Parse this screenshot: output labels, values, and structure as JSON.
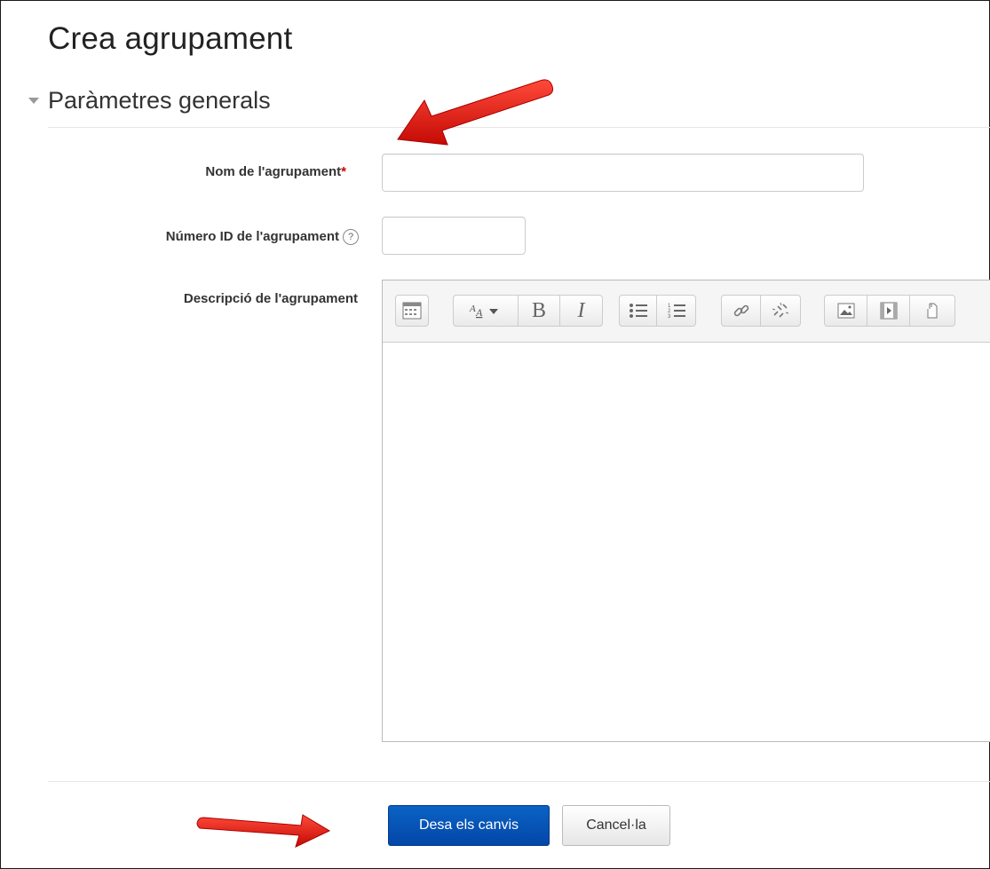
{
  "page": {
    "title": "Crea agrupament"
  },
  "section": {
    "title": "Paràmetres generals"
  },
  "form": {
    "name_label": "Nom de l'agrupament",
    "name_required": "*",
    "name_value": "",
    "idnumber_label": "Número ID de l'agrupament",
    "idnumber_help": "?",
    "idnumber_value": "",
    "description_label": "Descripció de l'agrupament"
  },
  "editor": {
    "toolbar": [
      [
        "toggle-toolbar-icon"
      ],
      [
        "font-style-icon",
        "bold-icon",
        "italic-icon"
      ],
      [
        "bullet-list-icon",
        "numbered-list-icon"
      ],
      [
        "link-icon",
        "unlink-icon"
      ],
      [
        "image-icon",
        "media-icon",
        "file-icon"
      ]
    ],
    "bold_glyph": "B",
    "italic_glyph": "I"
  },
  "buttons": {
    "save": "Desa els canvis",
    "cancel": "Cancel·la"
  },
  "colors": {
    "primary": "#0346a8",
    "required": "#cc0000",
    "annotation_arrow": "#e8140f"
  }
}
